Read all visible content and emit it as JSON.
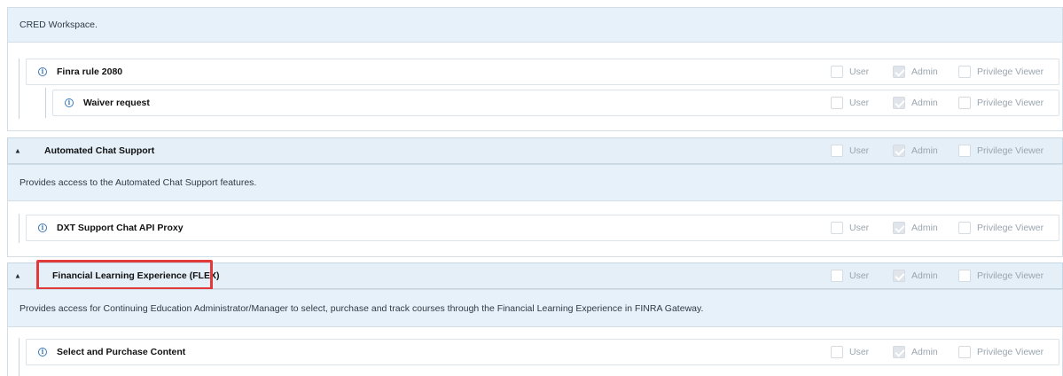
{
  "permission_labels": {
    "user": "User",
    "admin": "Admin",
    "privilege_viewer": "Privilege Viewer"
  },
  "cred_workspace": {
    "description": "CRED Workspace.",
    "rows": [
      {
        "label": "Finra rule 2080",
        "user": false,
        "admin": true,
        "privilege_viewer": false
      },
      {
        "label": "Waiver request",
        "user": false,
        "admin": true,
        "privilege_viewer": false
      }
    ]
  },
  "automated_chat_support": {
    "title": "Automated Chat Support",
    "user": false,
    "admin": true,
    "privilege_viewer": false,
    "description": "Provides access to the Automated Chat Support features.",
    "rows": [
      {
        "label": "DXT Support Chat API Proxy",
        "user": false,
        "admin": true,
        "privilege_viewer": false
      }
    ]
  },
  "flex": {
    "title": "Financial Learning Experience (FLEX)",
    "highlighted": true,
    "highlight_color": "#e23a3a",
    "user": false,
    "admin": true,
    "privilege_viewer": false,
    "description": "Provides access for Continuing Education Administrator/Manager to select, purchase and track courses through the Financial Learning Experience in FINRA Gateway.",
    "rows": [
      {
        "label": "Select and Purchase Content",
        "user": false,
        "admin": true,
        "privilege_viewer": false
      }
    ]
  },
  "icons": {
    "info": "info-circle-icon",
    "caret": "caret-up-icon"
  },
  "colors": {
    "header_bg": "#e4eff8",
    "desc_bg": "#e7f1f9",
    "info_blue": "#3a79b8"
  }
}
